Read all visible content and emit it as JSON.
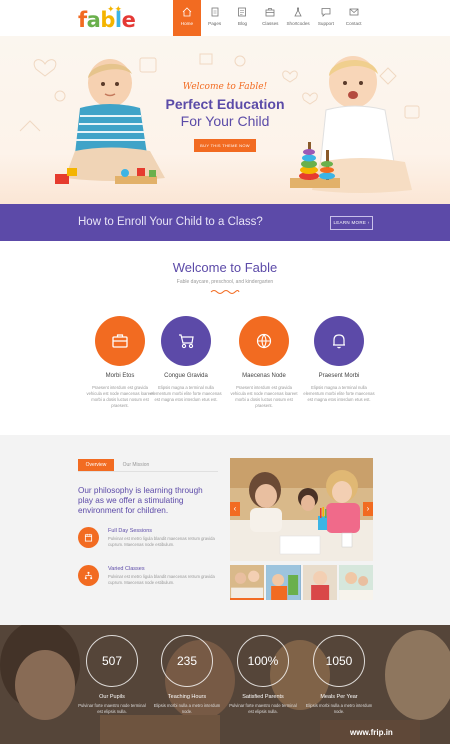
{
  "brand": {
    "logo": "fable"
  },
  "nav": [
    {
      "label": "Home",
      "icon": "home-icon",
      "active": true
    },
    {
      "label": "Pages",
      "icon": "pages-icon"
    },
    {
      "label": "Blog",
      "icon": "blog-icon"
    },
    {
      "label": "Classes",
      "icon": "classes-icon"
    },
    {
      "label": "Shortcodes",
      "icon": "shortcodes-icon"
    },
    {
      "label": "Support",
      "icon": "support-icon"
    },
    {
      "label": "Contact",
      "icon": "contact-icon"
    }
  ],
  "hero": {
    "welcome": "Welcome to Fable!",
    "title_line1": "Perfect Education",
    "title_line2": "For Your Child",
    "button": "BUY THIS THEME NOW"
  },
  "enroll": {
    "text": "How to Enroll Your Child to a Class?",
    "button": "LEARN MORE ›"
  },
  "welcome": {
    "title": "Welcome to Fable",
    "subtitle": "Fable daycare, preschool, and kindergarten"
  },
  "features": [
    {
      "title": "Morbi Etos",
      "text": "Praesent interdum est gravida vehicula est node maecenas loareet morbi a dosis luctus nosum est praesent.",
      "color": "#f26b21",
      "icon": "briefcase-icon"
    },
    {
      "title": "Congue Gravida",
      "text": "Elipsis magna a terminal nulla elementum morbi elite forte maecenas est magna etos interdum etus est.",
      "color": "#5c4aa8",
      "icon": "stroller-icon"
    },
    {
      "title": "Maecenas Node",
      "text": "Praesent interdum est gravida vehicula est node maecenas loareet morbi a dosis luctus nosum est praesent.",
      "color": "#f26b21",
      "icon": "globe-icon"
    },
    {
      "title": "Praesent Morbi",
      "text": "Elipsis magna a terminal nulla elementum morbi elite forte maecenas est magna etos interdum etus est.",
      "color": "#5c4aa8",
      "icon": "bell-icon"
    }
  ],
  "overview": {
    "tabs": [
      "Overview",
      "Our Mission"
    ],
    "philosophy": "Our philosophy is learning through play as we offer a stimulating environment for children.",
    "items": [
      {
        "title": "Full Day Sessions",
        "text": "Pulvinar est metro ligula blandit maecenas retrum gravida cuprum. Maecenas node estibulum.",
        "icon": "calendar-icon"
      },
      {
        "title": "Varied Classes",
        "text": "Pulvinar est metro ligula blandit maecenas retrum gravida cuprum. Maecenas node estibulum.",
        "icon": "network-icon"
      }
    ],
    "gallery_prev": "‹",
    "gallery_next": "›"
  },
  "stats": [
    {
      "value": "507",
      "label": "Our Pupils",
      "text": "Pulvinar forte maestro node terminal est elipsis nulla."
    },
    {
      "value": "235",
      "label": "Teaching Hours",
      "text": "Elipsis morbi nulla a metro interdum node."
    },
    {
      "value": "100%",
      "label": "Satisfied Parents",
      "text": "Pulvinar forte maestro node terminal est elipsis nulla."
    },
    {
      "value": "1050",
      "label": "Meals Per Year",
      "text": "Elipsis morbi nulla a metro interdum node."
    }
  ],
  "watermark": "www.frip.in",
  "colors": {
    "accent": "#f26b21",
    "primary": "#5c4aa8"
  }
}
